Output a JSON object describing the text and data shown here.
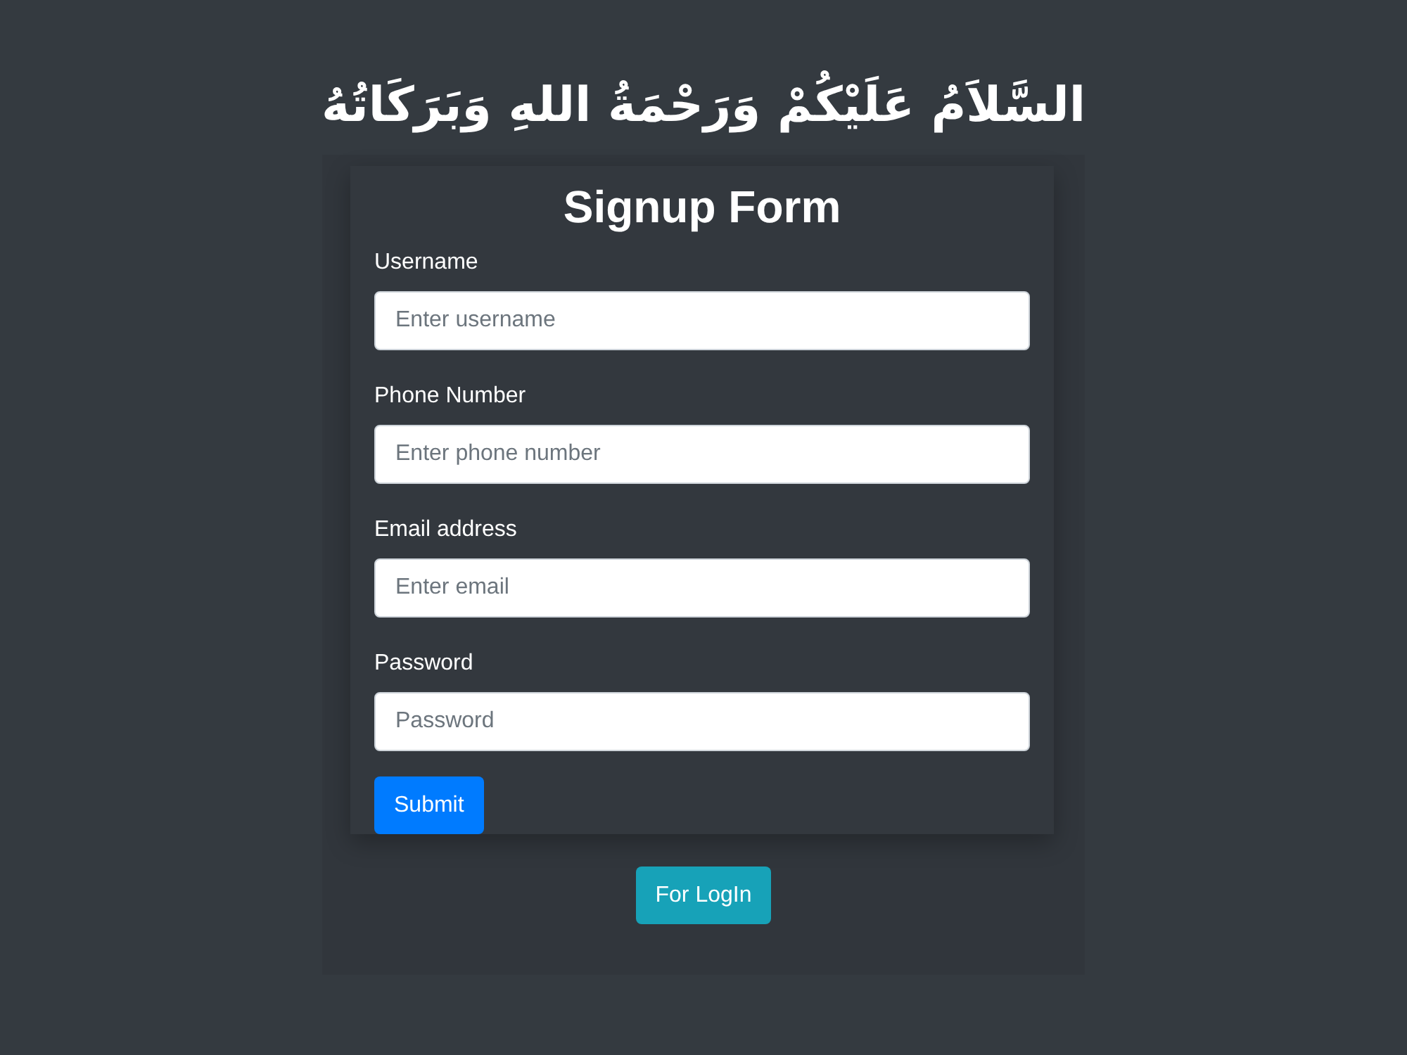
{
  "greeting": "السَّلاَمُ عَلَيْكُمْ وَرَحْمَةُ اللهِ وَبَرَكَاتُهُ",
  "form": {
    "title": "Signup Form",
    "fields": [
      {
        "label": "Username",
        "placeholder": "Enter username"
      },
      {
        "label": "Phone Number",
        "placeholder": "Enter phone number"
      },
      {
        "label": "Email address",
        "placeholder": "Enter email"
      },
      {
        "label": "Password",
        "placeholder": "Password"
      }
    ],
    "submit": "Submit"
  },
  "login_button": "For LogIn"
}
